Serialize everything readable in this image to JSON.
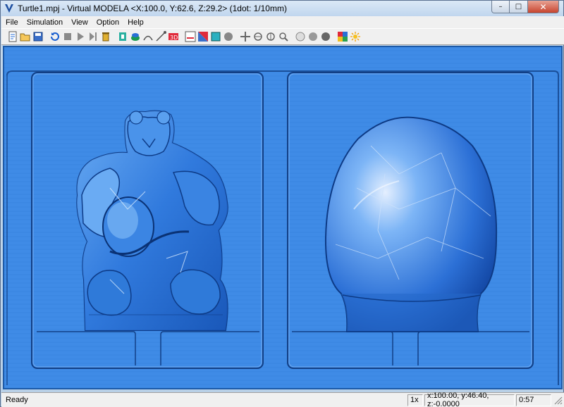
{
  "window": {
    "title": "Turtle1.mpj - Virtual MODELA <X:100.0, Y:62.6, Z:29.2> (1dot: 1/10mm)",
    "controls": {
      "minimize": "–",
      "maximize": "□",
      "close": "✕"
    }
  },
  "menu": [
    "File",
    "Simulation",
    "View",
    "Option",
    "Help"
  ],
  "toolbar": {
    "groups": [
      [
        "new-file-icon",
        "open-file-icon",
        "save-file-icon"
      ],
      [
        "replay-icon",
        "stop-icon",
        "play-icon",
        "step-icon",
        "trash-can-icon"
      ],
      [
        "tool-change-icon",
        "material-icon",
        "arc-cut-icon",
        "line-cut-icon",
        "3d-view-icon"
      ],
      [
        "section-view-icon",
        "red-split-icon",
        "flat-view-icon",
        "sphere-view-icon"
      ],
      [
        "move-icon",
        "rotate-x-icon",
        "rotate-y-icon",
        "zoom-icon"
      ],
      [
        "light-sphere-icon",
        "gray-sphere-icon",
        "dark-sphere-icon"
      ],
      [
        "color-settings-icon",
        "lighting-icon"
      ]
    ]
  },
  "statusbar": {
    "ready": "Ready",
    "zoom": "1x",
    "coords": "x:100.00, y:46.40, z:-0.0000",
    "time": "0:57"
  },
  "colors": {
    "material": "#3f8be6",
    "material_dark": "#1a4f9a",
    "highlight": "#d8e8fb"
  }
}
